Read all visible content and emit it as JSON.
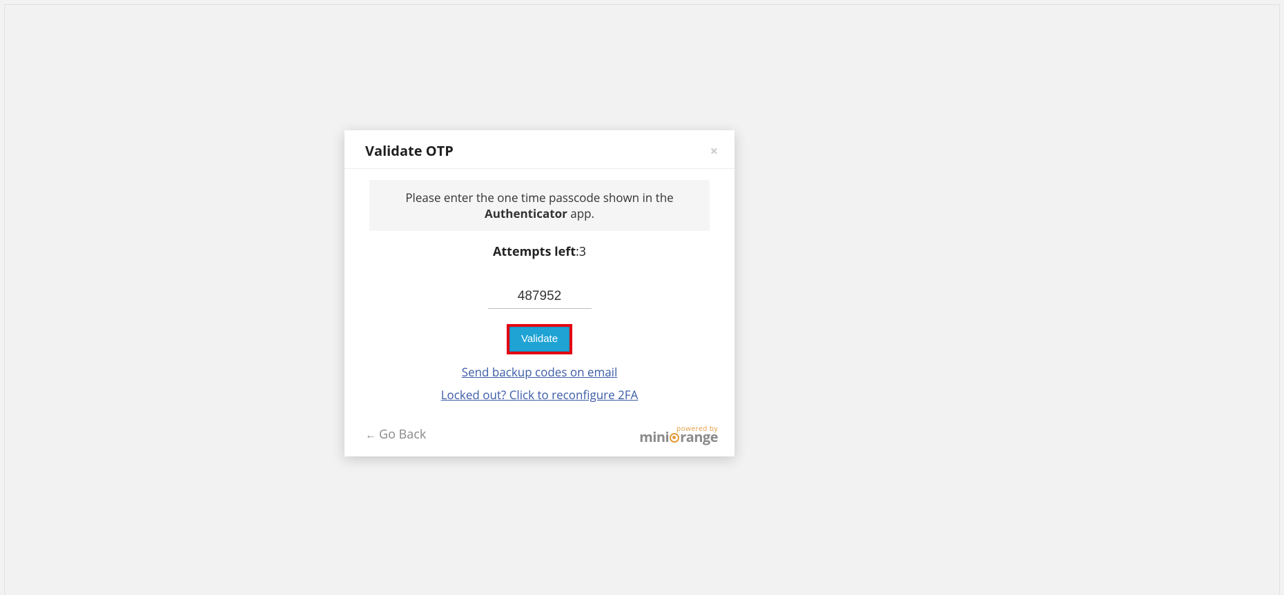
{
  "modal": {
    "title": "Validate OTP",
    "close_glyph": "×",
    "info_prefix": "Please enter the one time passcode shown in the ",
    "info_bold": "Authenticator",
    "info_suffix": " app.",
    "attempts_label": "Attempts left",
    "attempts_sep": ":",
    "attempts_value": "3",
    "otp_value": "487952",
    "validate_label": "Validate",
    "backup_link": "Send backup codes on email",
    "reconfigure_link": "Locked out? Click to reconfigure 2FA",
    "go_back_arrow": "←",
    "go_back_label": "Go Back",
    "powered_by": "powered by",
    "brand_prefix": "mini",
    "brand_suffix": "range"
  }
}
